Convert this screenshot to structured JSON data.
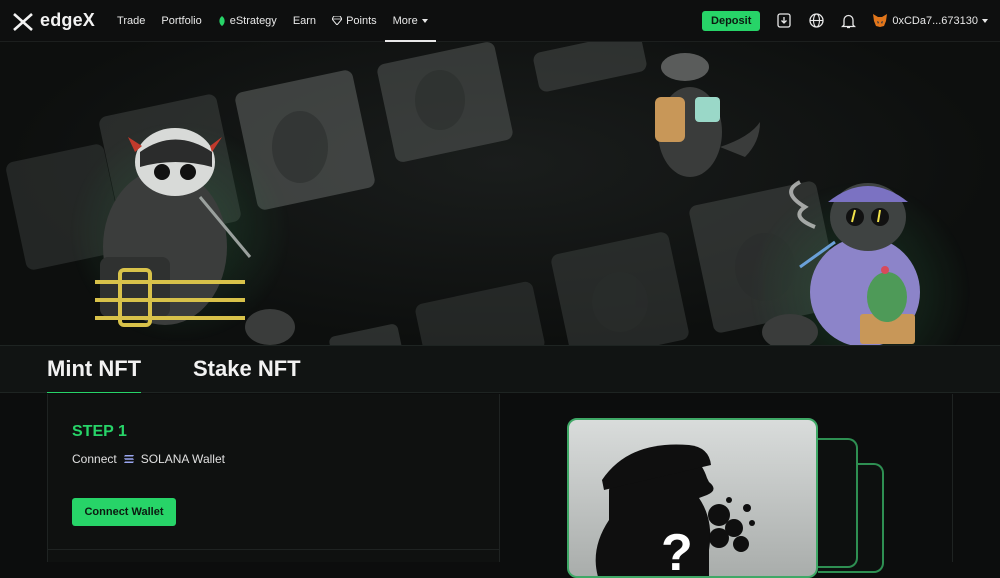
{
  "nav": {
    "logo_text": "edgeX",
    "items": [
      {
        "label": "Trade"
      },
      {
        "label": "Portfolio"
      },
      {
        "label": "eStrategy"
      },
      {
        "label": "Earn"
      },
      {
        "label": "Points"
      },
      {
        "label": "More"
      }
    ],
    "deposit_label": "Deposit",
    "wallet_address": "0xCDa7...673130",
    "icons": [
      "download-icon",
      "globe-icon",
      "bell-icon",
      "metamask-fox-icon"
    ]
  },
  "tabs": [
    {
      "label": "Mint NFT",
      "active": true
    },
    {
      "label": "Stake NFT",
      "active": false
    }
  ],
  "step": {
    "title": "STEP 1",
    "connect_prefix": "Connect",
    "wallet_name": "SOLANA Wallet",
    "button_label": "Connect Wallet"
  },
  "mystery": {
    "symbol": "?"
  },
  "colors": {
    "accent": "#27d468",
    "background": "#0c0d0d",
    "panel": "#0f1110"
  }
}
